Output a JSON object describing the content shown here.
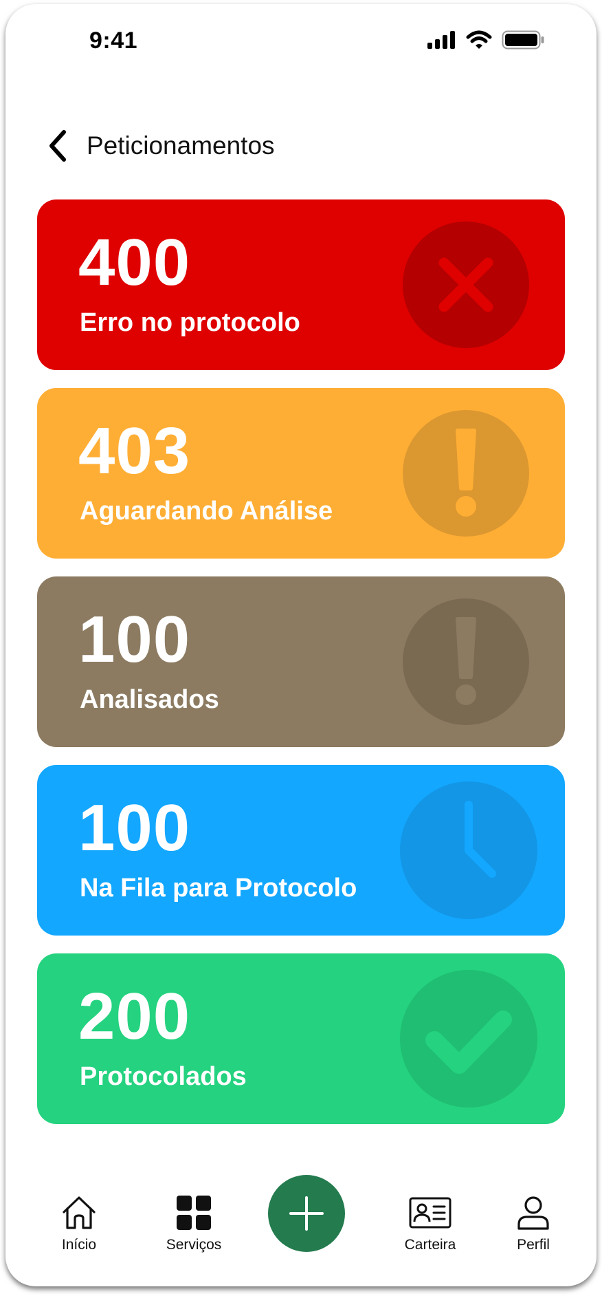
{
  "status_bar": {
    "time": "9:41"
  },
  "header": {
    "title": "Peticionamentos"
  },
  "cards": [
    {
      "count": "400",
      "label": "Erro no protocolo",
      "color": "#DF0000",
      "icon_bg": "#B40000",
      "icon": "close-icon"
    },
    {
      "count": "403",
      "label": "Aguardando Análise",
      "color": "#FFAE35",
      "icon_bg": "#DB9730",
      "icon": "exclamation-icon"
    },
    {
      "count": "100",
      "label": "Analisados",
      "color": "#8C7B61",
      "icon_bg": "#7B6A52",
      "icon": "exclamation-icon"
    },
    {
      "count": "100",
      "label": "Na Fila para Protocolo",
      "color": "#13A7FF",
      "icon_bg": "#1396E6",
      "icon": "clock-icon"
    },
    {
      "count": "200",
      "label": "Protocolados",
      "color": "#24D27F",
      "icon_bg": "#20BE72",
      "icon": "check-icon"
    }
  ],
  "bottom_nav": {
    "items": [
      {
        "label": "Início",
        "icon": "home-icon"
      },
      {
        "label": "Serviços",
        "icon": "grid-icon"
      },
      {
        "label": "Carteira",
        "icon": "id-card-icon"
      },
      {
        "label": "Perfil",
        "icon": "user-icon"
      }
    ],
    "fab_icon": "plus-icon",
    "fab_color": "#237B4E"
  }
}
